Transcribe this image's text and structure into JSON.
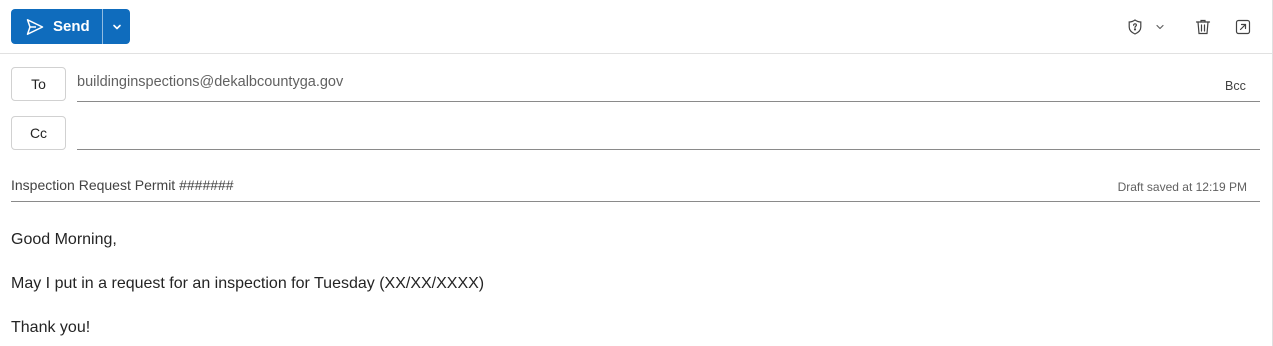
{
  "toolbar": {
    "send_label": "Send",
    "icons": [
      "send-icon",
      "chevron-down-icon",
      "sensitivity-shield-icon",
      "chevron-down-icon",
      "trash-icon",
      "pop-out-icon"
    ],
    "accent_color": "#0f6cbd"
  },
  "recipients": {
    "to_label": "To",
    "to_value": "buildinginspections@dekalbcountyga.gov",
    "cc_label": "Cc",
    "cc_value": "",
    "bcc_label": "Bcc"
  },
  "subject": {
    "value": "Inspection Request Permit #######",
    "draft_status": "Draft saved at 12:19 PM"
  },
  "body": {
    "lines": [
      "Good Morning,",
      "May I put in a request for an inspection for Tuesday (XX/XX/XXXX)",
      "Thank you!"
    ]
  }
}
